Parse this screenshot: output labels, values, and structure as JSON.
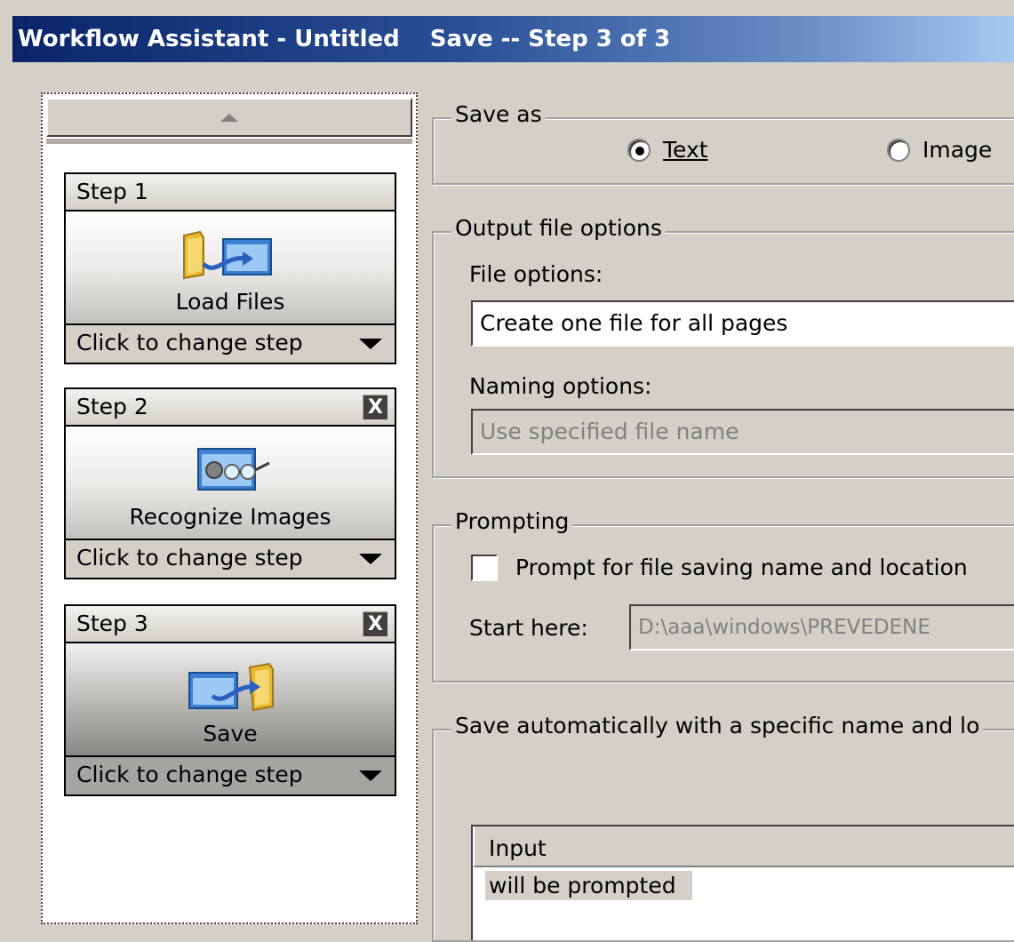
{
  "window": {
    "title": "Workflow Assistant - Untitled",
    "step_title": "Save -- Step 3 of 3"
  },
  "steps": [
    {
      "header": "Step 1",
      "name": "Load Files",
      "footer": "Click to change step",
      "closable": false,
      "icon": "load-files-icon"
    },
    {
      "header": "Step 2",
      "name": "Recognize Images",
      "footer": "Click to change step",
      "closable": true,
      "icon": "recognize-images-icon"
    },
    {
      "header": "Step 3",
      "name": "Save",
      "footer": "Click to change step",
      "closable": true,
      "icon": "save-icon",
      "selected": true
    }
  ],
  "close_glyph": "X",
  "save_as": {
    "legend": "Save as",
    "options": [
      {
        "label": "Text",
        "selected": true
      },
      {
        "label": "Image",
        "selected": false
      }
    ]
  },
  "output": {
    "legend": "Output file options",
    "file_options_label": "File options:",
    "file_options_value": "Create one file for all pages",
    "naming_label": "Naming options:",
    "naming_value": "Use specified file name"
  },
  "prompting": {
    "legend": "Prompting",
    "checkbox_label": "Prompt for file saving name and location",
    "checked": false,
    "start_here_label": "Start here:",
    "start_here_value": "D:\\aaa\\windows\\PREVEDENE"
  },
  "auto_save": {
    "legend": "Save automatically with a specific name and lo",
    "table_header": "Input",
    "table_value": "will be prompted"
  },
  "colors": {
    "titlebar_start": "#0a246a",
    "titlebar_end": "#a6caf0",
    "face": "#d4d0c8"
  }
}
